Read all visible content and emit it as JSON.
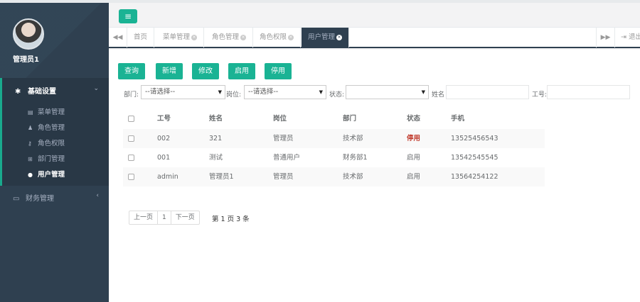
{
  "sidebar": {
    "admin_name": "管理员1",
    "groups": [
      {
        "label": "基础设置",
        "icon": "gear-icon",
        "items": [
          {
            "label": "菜单管理",
            "icon": "list-icon"
          },
          {
            "label": "角色管理",
            "icon": "users-icon"
          },
          {
            "label": "角色权限",
            "icon": "key-icon"
          },
          {
            "label": "部门管理",
            "icon": "sitemap-icon"
          },
          {
            "label": "用户管理",
            "icon": "user-icon",
            "current": true
          }
        ]
      },
      {
        "label": "财务管理",
        "icon": "credit-card-icon"
      }
    ]
  },
  "tabs": {
    "items": [
      {
        "label": "首页",
        "closable": false
      },
      {
        "label": "菜单管理",
        "closable": true
      },
      {
        "label": "角色管理",
        "closable": true
      },
      {
        "label": "角色权限",
        "closable": true
      },
      {
        "label": "用户管理",
        "closable": true,
        "active": true
      }
    ],
    "logout_label": "退出"
  },
  "toolbar": {
    "buttons": [
      "查询",
      "新增",
      "修改",
      "启用",
      "停用"
    ]
  },
  "filters": {
    "dept_label": "部门:",
    "dept_value": "--请选择--",
    "post_label": "岗位:",
    "post_value": "--请选择--",
    "status_label": "状态:",
    "status_value": "",
    "name_label": "姓名",
    "name_value": "",
    "jobno_label": "工号:",
    "jobno_value": ""
  },
  "table": {
    "columns": [
      "工号",
      "姓名",
      "岗位",
      "部门",
      "状态",
      "手机"
    ],
    "rows": [
      [
        "002",
        "321",
        "管理员",
        "技术部",
        "停用",
        "13525456543"
      ],
      [
        "001",
        "测试",
        "普通用户",
        "财务部1",
        "启用",
        "13542545545"
      ],
      [
        "admin",
        "管理员1",
        "管理员",
        "技术部",
        "启用",
        "13564254122"
      ]
    ]
  },
  "pagination": {
    "prev_label": "上一页",
    "current_page": "1",
    "next_label": "下一页",
    "info": "第 1 页 3 条"
  },
  "colors": {
    "sidebar_bg": "#2f4050",
    "accent": "#1ab394",
    "status_off": "#c0392b"
  }
}
